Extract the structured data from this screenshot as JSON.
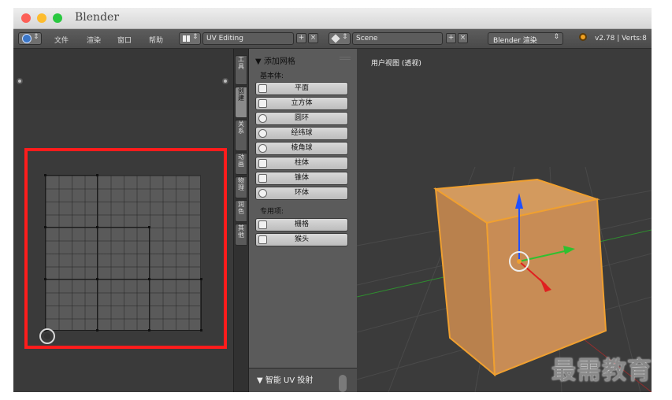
{
  "window": {
    "title": "Blender"
  },
  "header": {
    "menus": [
      "文件",
      "渲染",
      "窗口",
      "帮助"
    ],
    "layout_field": "UV Editing",
    "scene_field": "Scene",
    "engine": "Blender 渲染",
    "version_info": "v2.78 | Verts:8",
    "add_glyph": "+",
    "close_glyph": "×",
    "updown_glyph": "⇕"
  },
  "sidebar_tabs": [
    "工具",
    "创建",
    "关系",
    "动画",
    "物理",
    "润色",
    "其他"
  ],
  "tools_panel": {
    "title": "▼ 添加网格",
    "primitives_label": "基本体:",
    "primitives": [
      {
        "label": "平面",
        "icon": "plane-icon"
      },
      {
        "label": "立方体",
        "icon": "cube-icon"
      },
      {
        "label": "圆环",
        "icon": "circle-icon"
      },
      {
        "label": "经纬球",
        "icon": "uvsphere-icon"
      },
      {
        "label": "棱角球",
        "icon": "icosphere-icon"
      },
      {
        "label": "柱体",
        "icon": "cylinder-icon"
      },
      {
        "label": "锥体",
        "icon": "cone-icon"
      },
      {
        "label": "环体",
        "icon": "torus-icon"
      }
    ],
    "special_label": "专用项:",
    "special": [
      {
        "label": "栅格",
        "icon": "grid-icon"
      },
      {
        "label": "猴头",
        "icon": "monkey-icon"
      }
    ],
    "uv_project_title": "▼ 智能 UV 投射"
  },
  "viewport": {
    "label": "用户视图 (透视)"
  },
  "colors": {
    "highlight_box": "#ff1c1c",
    "cube_edge": "#f0a030",
    "cube_face": "#c98d55",
    "axis_x": "#e02020",
    "axis_y": "#30c030",
    "axis_z": "#2050ff"
  },
  "watermark": "最需教育"
}
